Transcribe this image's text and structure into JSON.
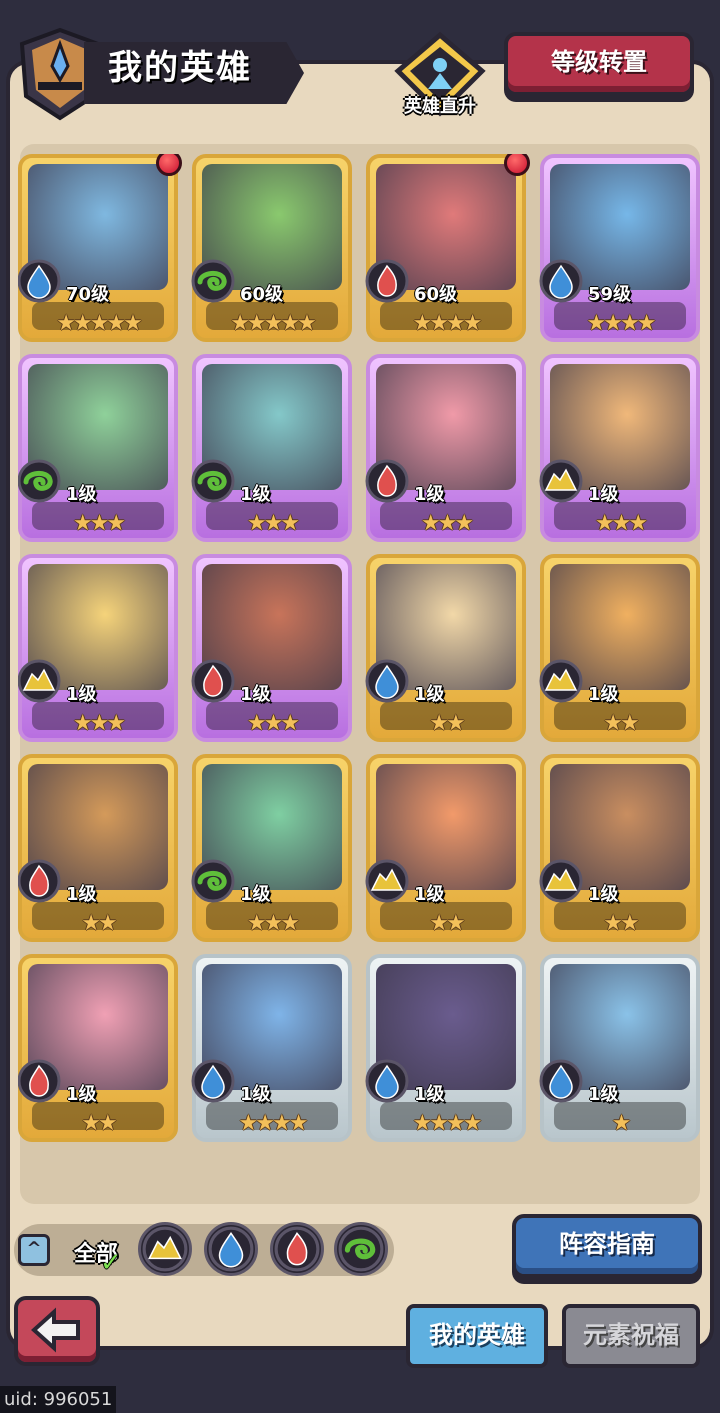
{
  "header": {
    "title": "我的英雄",
    "promote_label": "英雄直升",
    "level_reset_label": "等级转置"
  },
  "heroes": [
    {
      "level": "70级",
      "stars": 5,
      "element": "water",
      "frame": "gold",
      "alert": true,
      "portrait_color": "#7fb8e0"
    },
    {
      "level": "60级",
      "stars": 5,
      "element": "wind",
      "frame": "gold",
      "alert": false,
      "portrait_color": "#8ac96e"
    },
    {
      "level": "60级",
      "stars": 4,
      "element": "fire",
      "frame": "gold",
      "alert": true,
      "portrait_color": "#e07a7a"
    },
    {
      "level": "59级",
      "stars": 4,
      "element": "water",
      "frame": "purple",
      "alert": false,
      "portrait_color": "#76b7e8"
    },
    {
      "level": "1级",
      "stars": 3,
      "element": "wind",
      "frame": "purple",
      "alert": false,
      "portrait_color": "#8fd19a"
    },
    {
      "level": "1级",
      "stars": 3,
      "element": "wind",
      "frame": "purple",
      "alert": false,
      "portrait_color": "#84c8c9"
    },
    {
      "level": "1级",
      "stars": 3,
      "element": "fire",
      "frame": "purple",
      "alert": false,
      "portrait_color": "#f09aa8"
    },
    {
      "level": "1级",
      "stars": 3,
      "element": "earth",
      "frame": "purple",
      "alert": false,
      "portrait_color": "#f0b87a"
    },
    {
      "level": "1级",
      "stars": 3,
      "element": "earth",
      "frame": "purple",
      "alert": false,
      "portrait_color": "#f5d37a"
    },
    {
      "level": "1级",
      "stars": 3,
      "element": "fire",
      "frame": "purple",
      "alert": false,
      "portrait_color": "#c8745a"
    },
    {
      "level": "1级",
      "stars": 2,
      "element": "water",
      "frame": "gold",
      "alert": false,
      "portrait_color": "#f2d8a8"
    },
    {
      "level": "1级",
      "stars": 2,
      "element": "earth",
      "frame": "gold",
      "alert": false,
      "portrait_color": "#f0b060"
    },
    {
      "level": "1级",
      "stars": 2,
      "element": "fire",
      "frame": "gold",
      "alert": false,
      "portrait_color": "#d49a5a"
    },
    {
      "level": "1级",
      "stars": 3,
      "element": "wind",
      "frame": "gold",
      "alert": false,
      "portrait_color": "#7fcfa2"
    },
    {
      "level": "1级",
      "stars": 2,
      "element": "earth",
      "frame": "gold",
      "alert": false,
      "portrait_color": "#f29a6a"
    },
    {
      "level": "1级",
      "stars": 2,
      "element": "earth",
      "frame": "gold",
      "alert": false,
      "portrait_color": "#c98e60"
    },
    {
      "level": "1级",
      "stars": 2,
      "element": "fire",
      "frame": "gold",
      "alert": false,
      "portrait_color": "#f0a0b4"
    },
    {
      "level": "1级",
      "stars": 4,
      "element": "water",
      "frame": "silver",
      "alert": false,
      "portrait_color": "#7fb4e8"
    },
    {
      "level": "1级",
      "stars": 4,
      "element": "water",
      "frame": "silver",
      "alert": false,
      "portrait_color": "#6a5c8e"
    },
    {
      "level": "1级",
      "stars": 1,
      "element": "water",
      "frame": "silver",
      "alert": false,
      "portrait_color": "#8ac2e8"
    }
  ],
  "filter": {
    "all_label": "全部",
    "elements": [
      "earth",
      "water",
      "fire",
      "wind"
    ]
  },
  "lineup_guide_label": "阵容指南",
  "tabs": {
    "my_heroes": "我的英雄",
    "element_blessing": "元素祝福"
  },
  "uid_text": "uid: 996051",
  "colors": {
    "water": "#3f8fd8",
    "wind": "#5fbf3a",
    "fire": "#e0504e",
    "earth": "#e8c33a"
  }
}
